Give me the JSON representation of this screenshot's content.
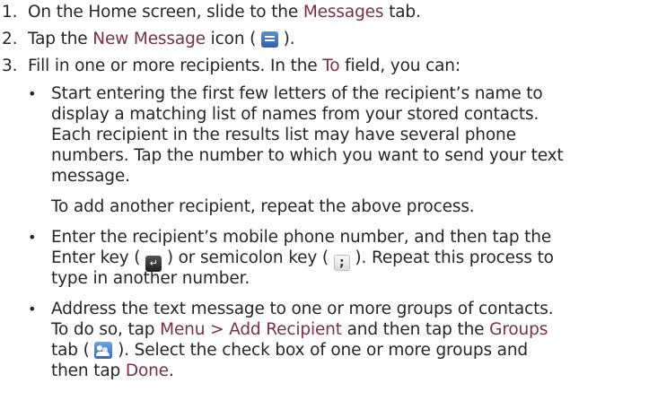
{
  "steps": [
    {
      "number": "1.",
      "lines": [
        {
          "pre": "On the Home screen, slide to the ",
          "hl": "Messages",
          "post": " tab."
        }
      ]
    },
    {
      "number": "2.",
      "lines": [
        {
          "pre": "Tap the ",
          "hl": "New Message",
          "post": " icon ( ",
          "icon": "new-message-icon",
          "post2": " )."
        }
      ]
    },
    {
      "number": "3.",
      "lines": [
        {
          "pre": "Fill in one or more recipients. In the ",
          "hl": "To",
          "post": " field, you can:"
        }
      ]
    }
  ],
  "bullets": [
    {
      "lines": [
        "Start entering the first few letters of the recipient’s name to",
        "display a matching list of names from your stored contacts.",
        "Each recipient in the results list may have several phone",
        "numbers. Tap the number to which you want to send your text",
        "message."
      ],
      "note": "To add another recipient, repeat the above process."
    },
    {
      "lines": [
        "Enter the recipient’s mobile phone number, and then tap the",
        {
          "t1": "Enter key ( ",
          "icon1": "enter-key-icon",
          "t2": " ) or semicolon key ( ",
          "icon2": "semicolon-key-icon",
          "t3": " ). Repeat this process to"
        },
        "type in another number."
      ]
    },
    {
      "lines": [
        "Address the text message to one or more groups of contacts.",
        {
          "t1": "To do so, tap ",
          "hl1": "Menu > Add Recipient",
          "t2": " and then tap the ",
          "hl2": "Groups"
        },
        {
          "t1": "tab ( ",
          "icon": "groups-tab-icon",
          "t2": " ). Select the check box of one or more groups and"
        },
        {
          "t1": "then tap ",
          "hl": "Done",
          "t2": "."
        }
      ]
    }
  ],
  "bullet_char": "•",
  "colors": {
    "text": "#262626",
    "highlight": "#7a2f4a"
  }
}
